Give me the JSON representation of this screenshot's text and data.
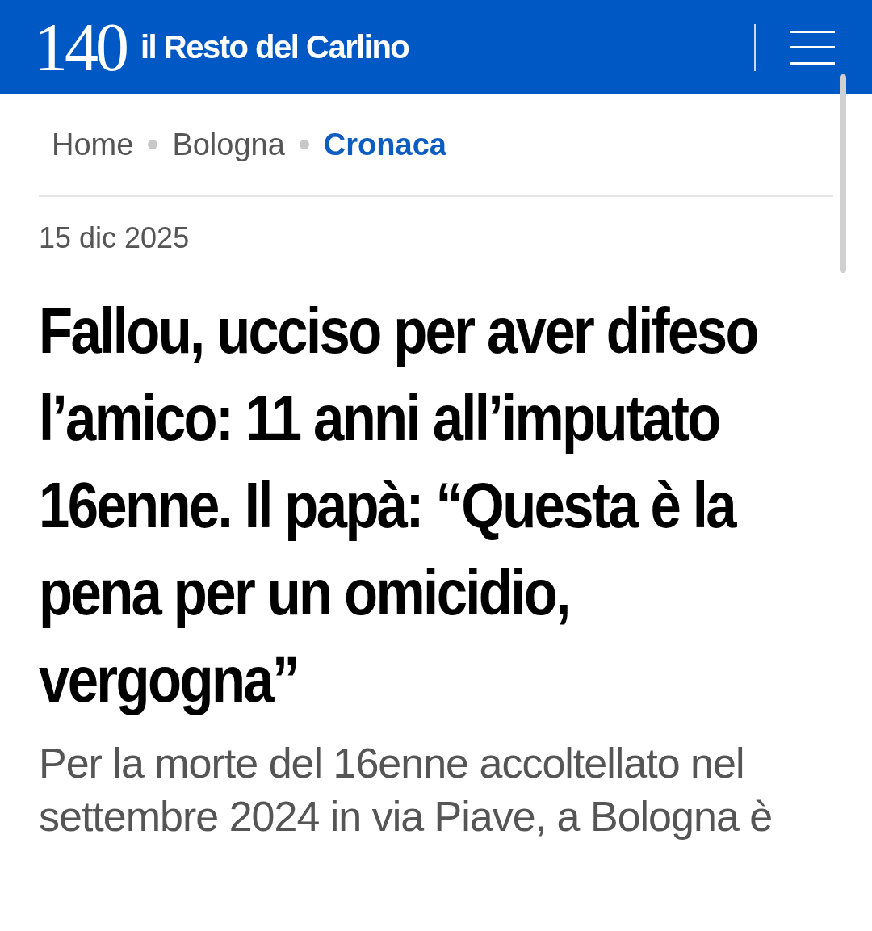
{
  "header": {
    "logo_mark": "140",
    "logo_text": "il Resto del Carlino"
  },
  "breadcrumb": [
    {
      "label": "Home",
      "selected": false
    },
    {
      "label": "Bologna",
      "selected": false
    },
    {
      "label": "Cronaca",
      "selected": true
    }
  ],
  "article": {
    "date": "15 dic 2025",
    "headline": "Fallou, ucciso per aver difeso l’amico: 11 anni all’imputato 16enne. Il papà: “Questa è la pena per un omicidio, vergogna”",
    "summary": "Per la morte del 16enne accoltellato nel settembre 2024 in via Piave, a Bologna è"
  }
}
